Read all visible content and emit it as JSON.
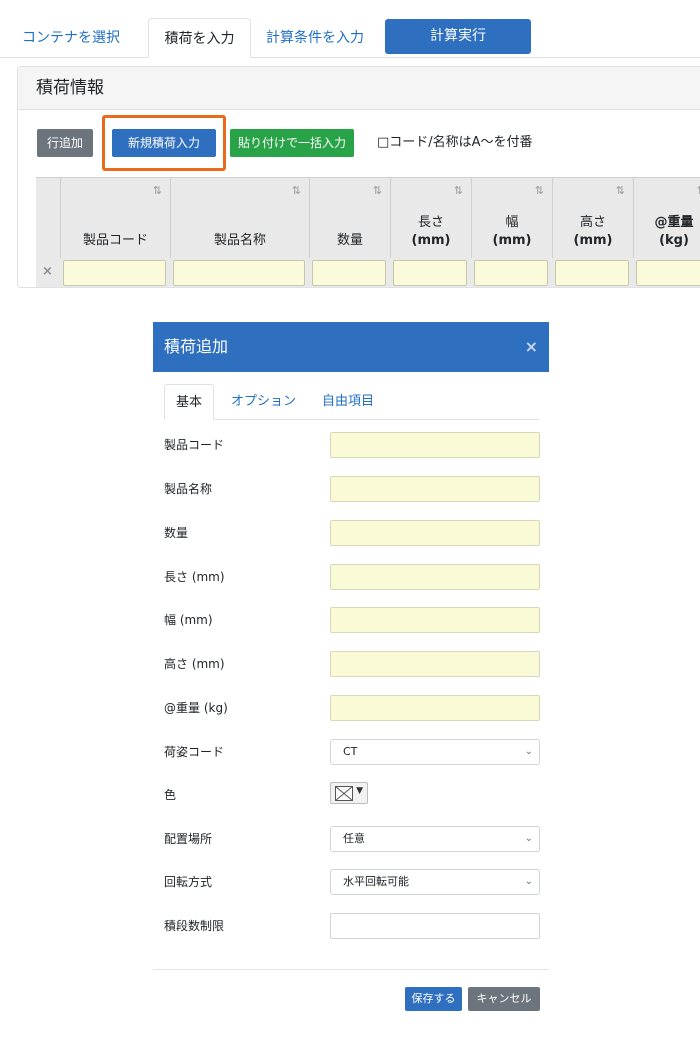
{
  "tabs": {
    "select_container": "コンテナを選択",
    "input_cargo": "積荷を入力",
    "input_conditions": "計算条件を入力",
    "run": "計算実行"
  },
  "panel": {
    "title": "積荷情報",
    "add_row": "行追加",
    "new_cargo": "新規積荷入力",
    "paste_bulk": "貼り付けで一括入力",
    "suffix_option": "□コード/名称はA〜を付番"
  },
  "grid": {
    "columns": [
      {
        "line1": "",
        "line2": "製品コード"
      },
      {
        "line1": "",
        "line2": "製品名称"
      },
      {
        "line1": "",
        "line2": "数量"
      },
      {
        "line1": "長さ",
        "line2": "(mm)"
      },
      {
        "line1": "幅",
        "line2": "(mm)"
      },
      {
        "line1": "高さ",
        "line2": "(mm)"
      },
      {
        "line1": "@重量",
        "line2": "(kg)"
      }
    ],
    "sort_icon": "⇅",
    "delete_icon": "×"
  },
  "modal": {
    "title": "積荷追加",
    "close": "×",
    "tabs": {
      "basic": "基本",
      "option": "オプション",
      "free": "自由項目"
    },
    "fields": {
      "product_code": "製品コード",
      "product_name": "製品名称",
      "quantity": "数量",
      "length": "長さ (mm)",
      "width": "幅 (mm)",
      "height": "高さ (mm)",
      "weight": "@重量 (kg)",
      "package_code": "荷姿コード",
      "color": "色",
      "placement": "配置場所",
      "rotation": "回転方式",
      "stack_limit": "積段数制限"
    },
    "values": {
      "package_code": "CT",
      "placement": "任意",
      "rotation": "水平回転可能"
    },
    "save": "保存する",
    "cancel": "キャンセル"
  },
  "colors": {
    "primary": "#2f6fbf",
    "success": "#29a347",
    "secondary": "#6c757d",
    "highlight": "#ea6a1b",
    "input_bg": "#fafad6"
  }
}
